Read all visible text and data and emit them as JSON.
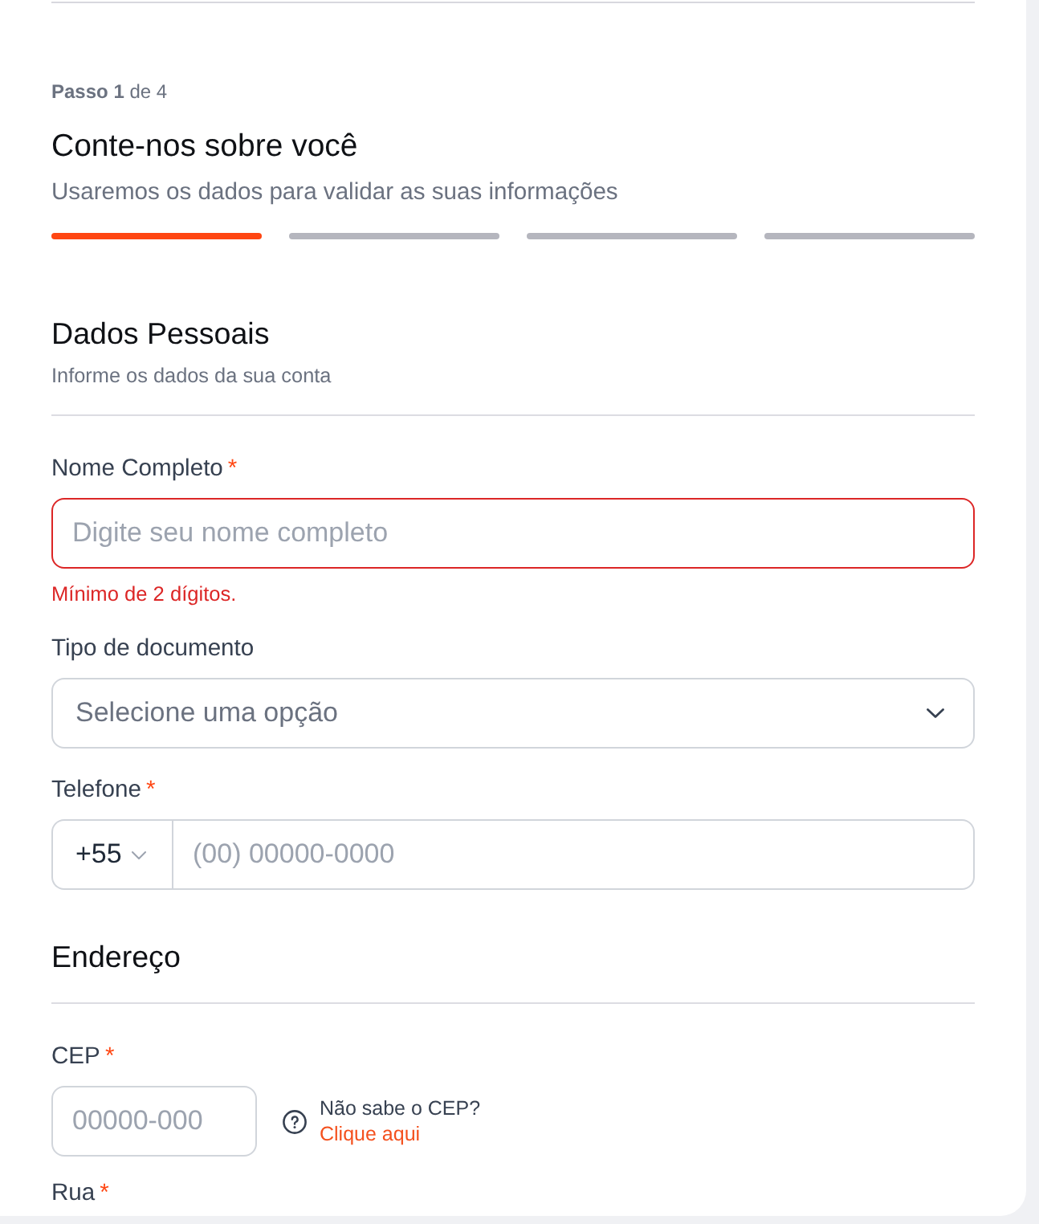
{
  "stepper": {
    "counter": "**Passo 1** de 4",
    "title": "Conte-nos sobre você",
    "subtitle": "Usaremos os dados para validar as suas informações",
    "steps": [
      {
        "completed": true
      },
      {
        "completed": false
      },
      {
        "completed": false
      },
      {
        "completed": false
      }
    ]
  },
  "sections": [
    {
      "title": "Dados Pessoais",
      "description": "Informe os dados da sua conta",
      "fields": [
        {
          "kind": "text",
          "label": "Nome Completo",
          "asterisk": "*",
          "placeholder": "Digite seu nome completo",
          "error": "Mínimo de 2 dígitos."
        },
        {
          "kind": "select",
          "label": "Tipo de documento",
          "placeholder": "Selecione uma opção"
        },
        {
          "kind": "phone",
          "label": "Telefone",
          "asterisk": "*",
          "country_code": "+55",
          "placeholder": "(00) 00000-0000"
        }
      ]
    },
    {
      "title": "Endereço",
      "fields": [
        {
          "kind": "cep",
          "label": "CEP",
          "asterisk": "*",
          "placeholder": "00000-000",
          "help": {
            "question": "Não sabe o CEP?",
            "link": "Clique aqui"
          }
        },
        {
          "kind": "label",
          "label": "Rua",
          "asterisk": "*"
        }
      ]
    }
  ]
}
